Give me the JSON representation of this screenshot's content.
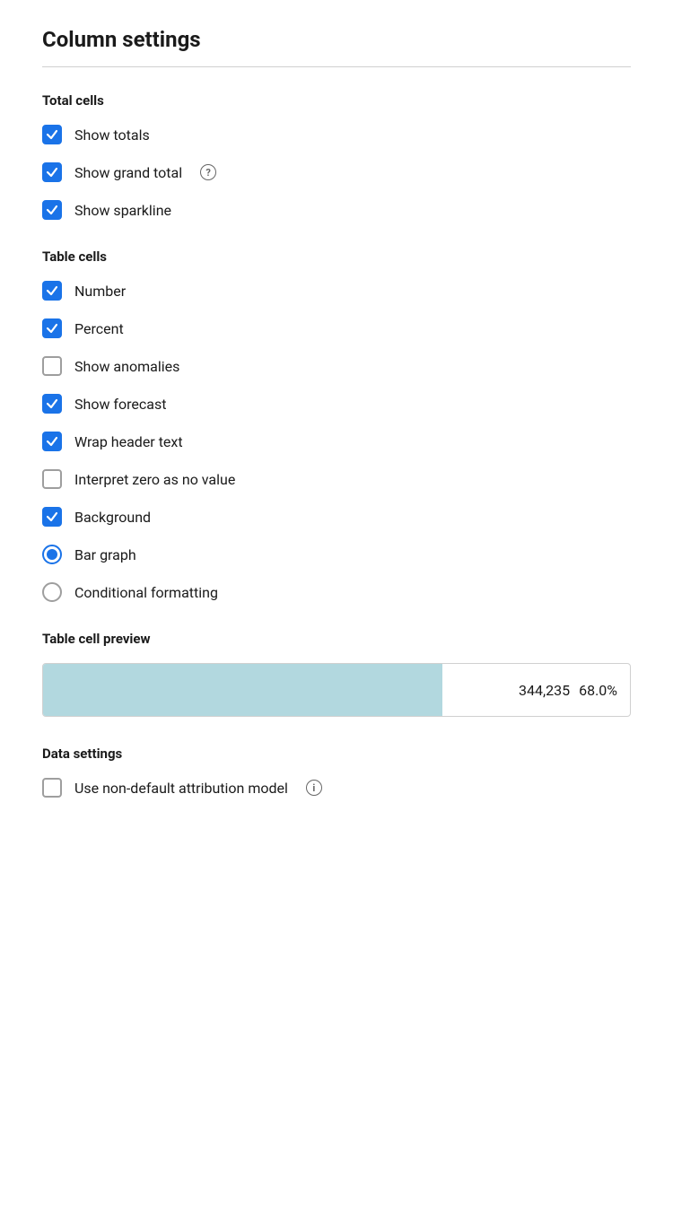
{
  "page": {
    "title": "Column settings"
  },
  "total_cells": {
    "label": "Total cells",
    "items": [
      {
        "id": "show-totals",
        "label": "Show totals",
        "checked": true,
        "has_info": false
      },
      {
        "id": "show-grand-total",
        "label": "Show grand total",
        "checked": true,
        "has_info": true
      },
      {
        "id": "show-sparkline",
        "label": "Show sparkline",
        "checked": true,
        "has_info": false
      }
    ]
  },
  "table_cells": {
    "label": "Table cells",
    "checkboxes": [
      {
        "id": "number",
        "label": "Number",
        "checked": true
      },
      {
        "id": "percent",
        "label": "Percent",
        "checked": true
      },
      {
        "id": "show-anomalies",
        "label": "Show anomalies",
        "checked": false
      },
      {
        "id": "show-forecast",
        "label": "Show forecast",
        "checked": true
      },
      {
        "id": "wrap-header-text",
        "label": "Wrap header text",
        "checked": true
      },
      {
        "id": "interpret-zero",
        "label": "Interpret zero as no value",
        "checked": false
      },
      {
        "id": "background",
        "label": "Background",
        "checked": true
      }
    ],
    "radios": [
      {
        "id": "bar-graph",
        "label": "Bar graph",
        "selected": true
      },
      {
        "id": "conditional-formatting",
        "label": "Conditional formatting",
        "selected": false
      }
    ]
  },
  "table_cell_preview": {
    "label": "Table cell preview",
    "value": "344,235",
    "percent": "68.0%",
    "bar_fill_percent": 68
  },
  "data_settings": {
    "label": "Data settings",
    "items": [
      {
        "id": "non-default-attribution",
        "label": "Use non-default attribution model",
        "checked": false,
        "has_info": true
      }
    ]
  },
  "icons": {
    "checkmark": "✓",
    "info": "?"
  }
}
